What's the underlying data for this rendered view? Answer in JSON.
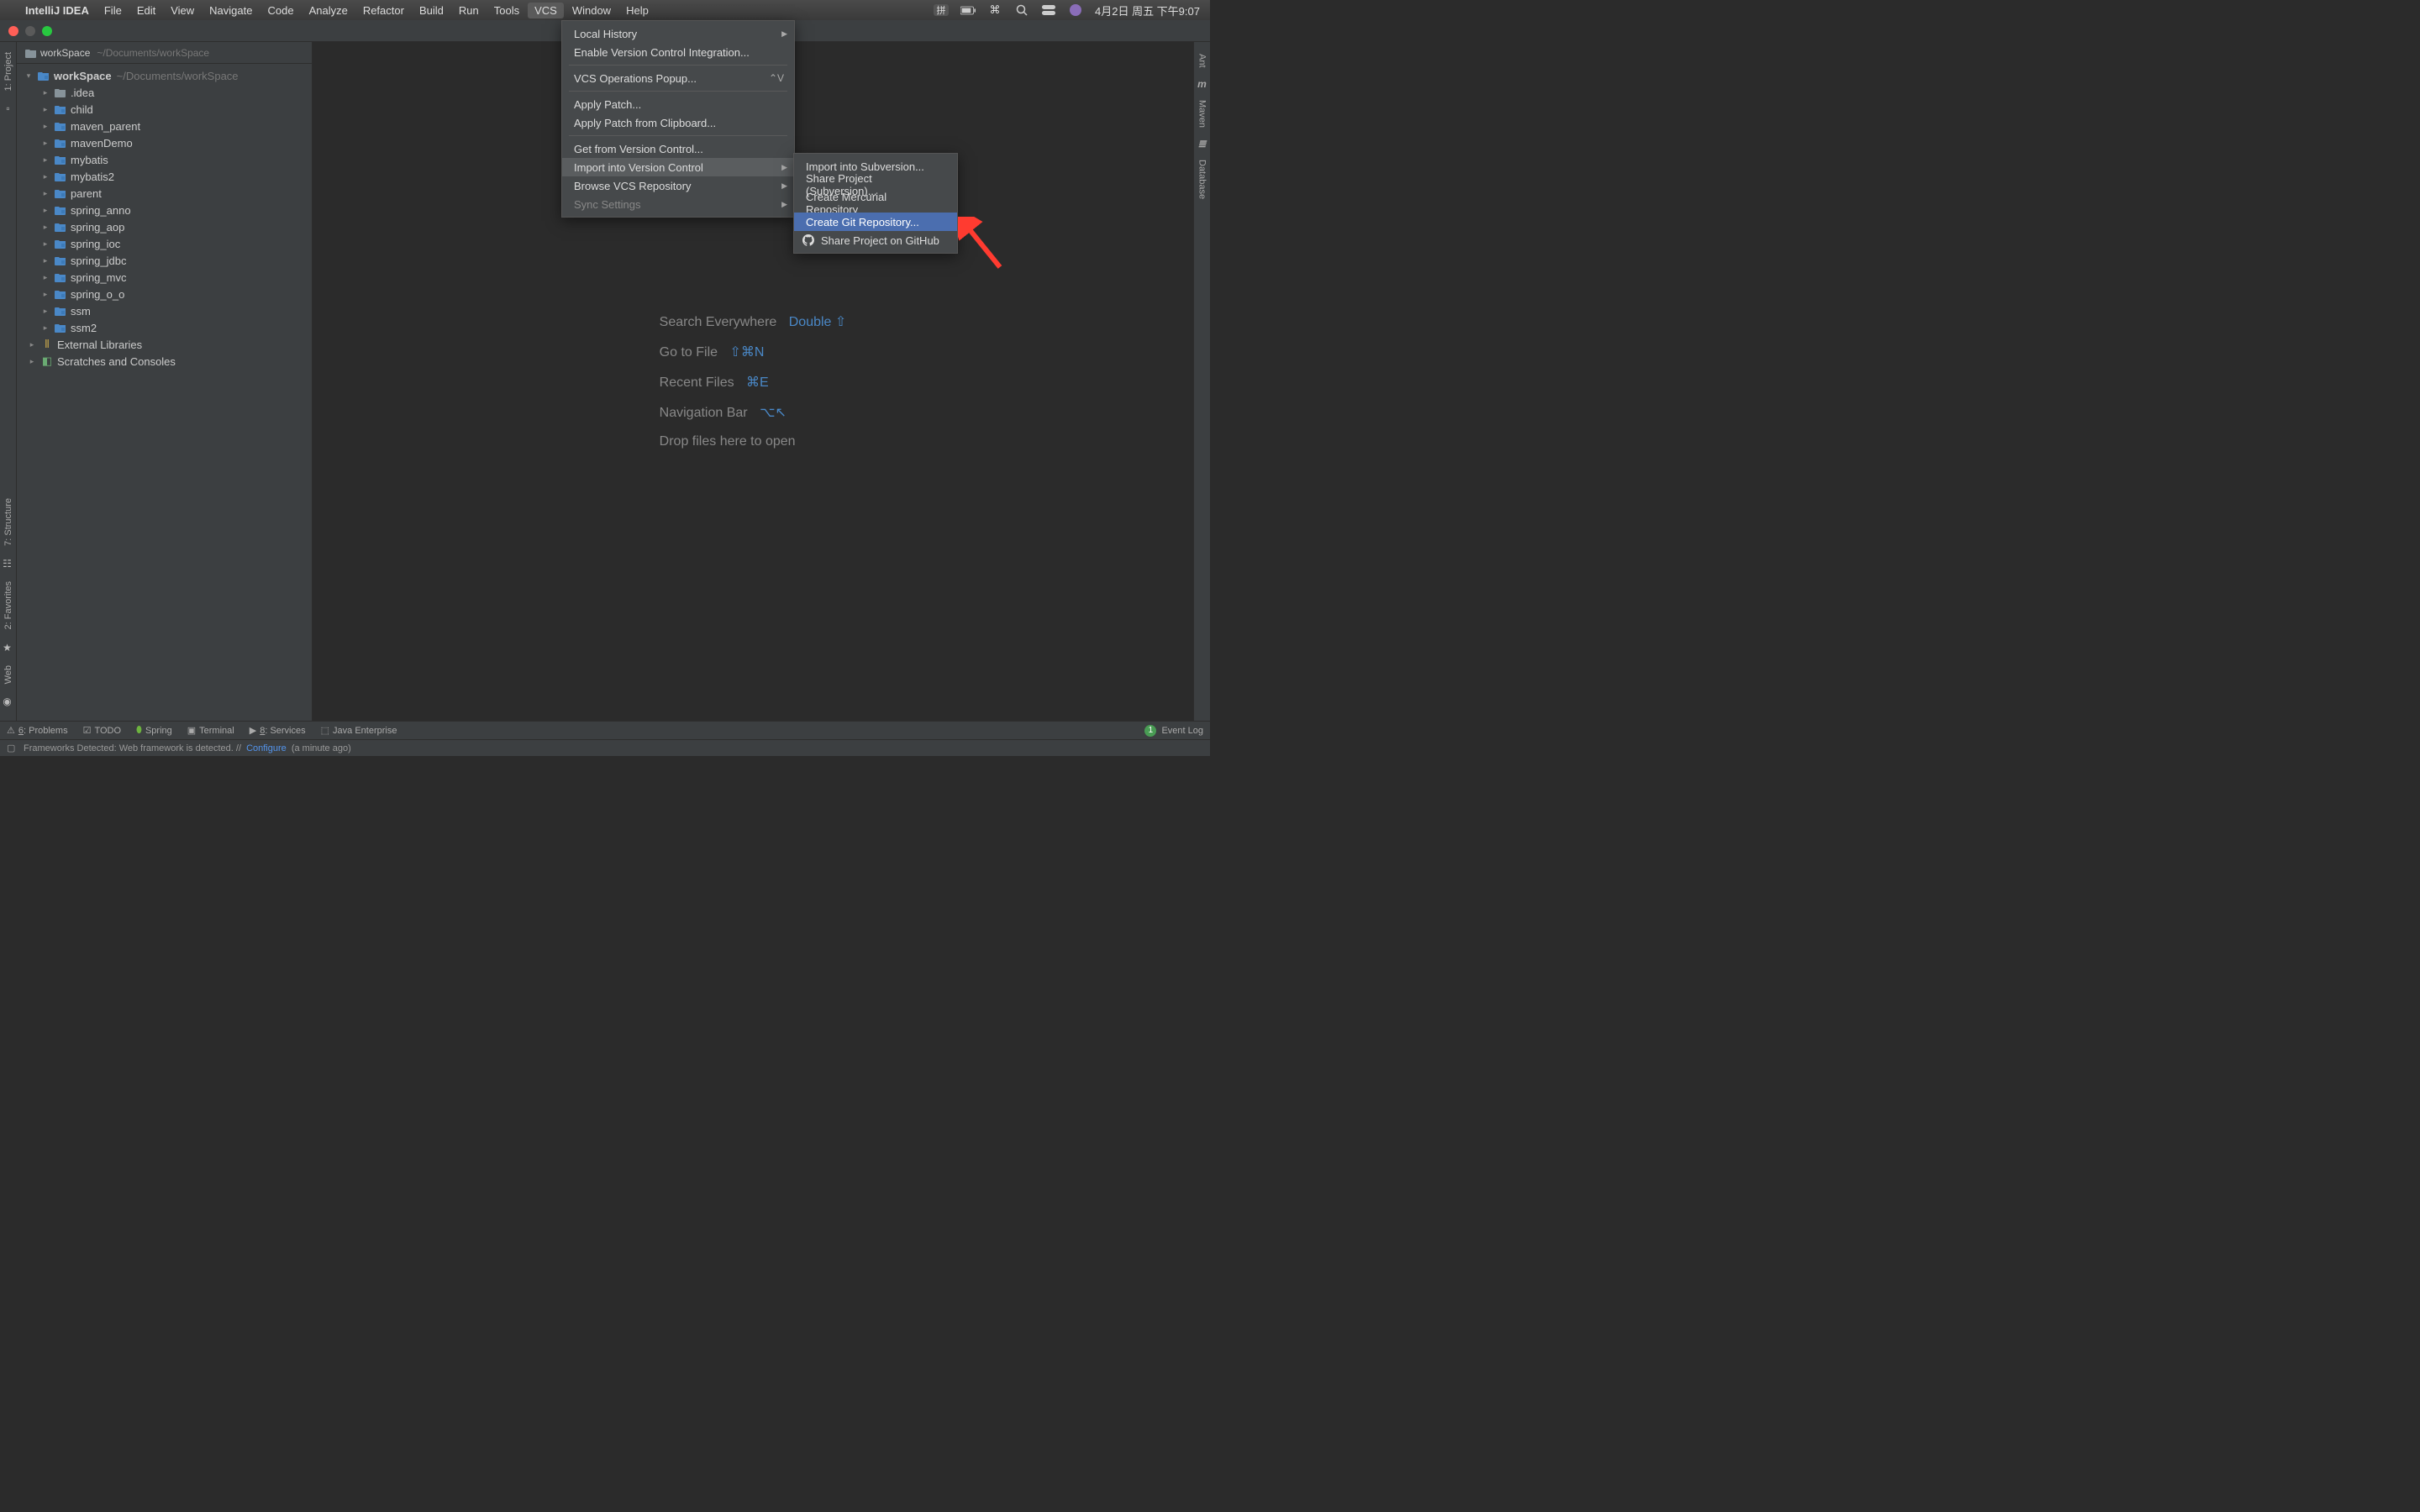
{
  "macos": {
    "app_name": "IntelliJ IDEA",
    "menu": [
      "File",
      "Edit",
      "View",
      "Navigate",
      "Code",
      "Analyze",
      "Refactor",
      "Build",
      "Run",
      "Tools",
      "VCS",
      "Window",
      "Help"
    ],
    "clock": "4月2日 周五 下午9:07",
    "input_method": "拼"
  },
  "window": {
    "title": "workSpace"
  },
  "breadcrumb": {
    "name": "workSpace",
    "path": "~/Documents/workSpace"
  },
  "tree": {
    "root": {
      "label": "workSpace",
      "suffix": "~/Documents/workSpace"
    },
    "children": [
      {
        "label": ".idea",
        "type": "dir"
      },
      {
        "label": "child",
        "type": "module"
      },
      {
        "label": "maven_parent",
        "type": "module"
      },
      {
        "label": "mavenDemo",
        "type": "module"
      },
      {
        "label": "mybatis",
        "type": "module"
      },
      {
        "label": "mybatis2",
        "type": "module"
      },
      {
        "label": "parent",
        "type": "module"
      },
      {
        "label": "spring_anno",
        "type": "module"
      },
      {
        "label": "spring_aop",
        "type": "module"
      },
      {
        "label": "spring_ioc",
        "type": "module"
      },
      {
        "label": "spring_jdbc",
        "type": "module"
      },
      {
        "label": "spring_mvc",
        "type": "module"
      },
      {
        "label": "spring_o_o",
        "type": "module"
      },
      {
        "label": "ssm",
        "type": "module"
      },
      {
        "label": "ssm2",
        "type": "module"
      }
    ],
    "extras": [
      {
        "label": "External Libraries",
        "icon": "libs"
      },
      {
        "label": "Scratches and Consoles",
        "icon": "scratch"
      }
    ]
  },
  "left_stripe": {
    "project": "1: Project",
    "structure": "7: Structure",
    "favorites": "2: Favorites",
    "web": "Web"
  },
  "right_stripe": {
    "ant": "Ant",
    "maven": "Maven",
    "database": "Database"
  },
  "hints": {
    "search": {
      "label": "Search Everywhere",
      "shortcut": "Double ⇧"
    },
    "gotofile": {
      "label": "Go to File",
      "shortcut": "⇧⌘N"
    },
    "recent": {
      "label": "Recent Files",
      "shortcut": "⌘E"
    },
    "navbar": {
      "label": "Navigation Bar",
      "shortcut": "⌥↖"
    },
    "drop": {
      "label": "Drop files here to open"
    }
  },
  "vcs_menu": {
    "items": [
      {
        "label": "Local History",
        "arrow": true
      },
      {
        "label": "Enable Version Control Integration..."
      },
      {
        "sep": true
      },
      {
        "label": "VCS Operations Popup...",
        "shortcut": "⌃V"
      },
      {
        "sep": true
      },
      {
        "label": "Apply Patch..."
      },
      {
        "label": "Apply Patch from Clipboard..."
      },
      {
        "sep": true
      },
      {
        "label": "Get from Version Control..."
      },
      {
        "label": "Import into Version Control",
        "arrow": true,
        "highlighted": true
      },
      {
        "label": "Browse VCS Repository",
        "arrow": true
      },
      {
        "label": "Sync Settings",
        "arrow": true,
        "disabled": true
      }
    ]
  },
  "import_submenu": {
    "items": [
      {
        "label": "Import into Subversion..."
      },
      {
        "label": "Share Project (Subversion)..."
      },
      {
        "label": "Create Mercurial Repository"
      },
      {
        "label": "Create Git Repository...",
        "hover": true
      },
      {
        "label": "Share Project on GitHub",
        "icon": "github"
      }
    ]
  },
  "bottom_toolbar": {
    "problems": {
      "key": "6",
      "label": ": Problems"
    },
    "todo": "TODO",
    "spring": "Spring",
    "terminal": "Terminal",
    "services": {
      "key": "8",
      "label": ": Services"
    },
    "javaee": "Java Enterprise",
    "eventlog": "Event Log",
    "badge": "1"
  },
  "status": {
    "message_prefix": "Frameworks Detected: Web framework is detected. // ",
    "configure": "Configure",
    "time": " (a minute ago)"
  }
}
